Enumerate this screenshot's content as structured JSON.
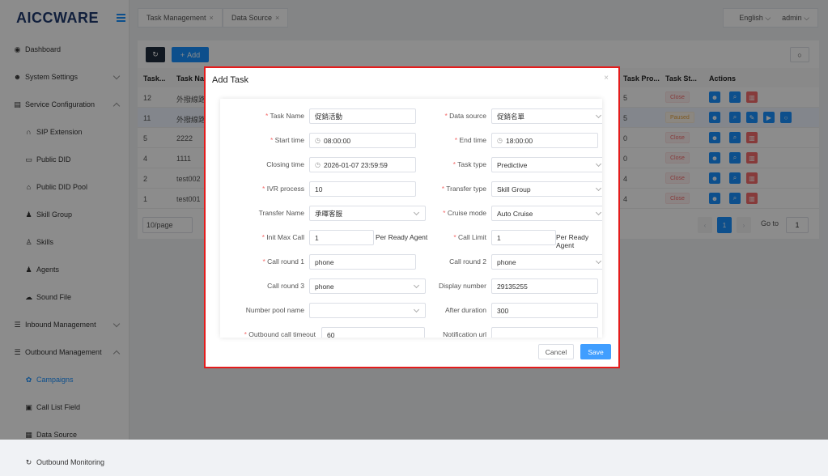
{
  "brand": {
    "name_a": "AICC",
    "name_b": "WARE"
  },
  "sidebar": {
    "items": [
      {
        "label": "Dashboard",
        "icon": "dashboard-icon"
      },
      {
        "label": "System Settings",
        "icon": "users-cog-icon"
      },
      {
        "label": "Service Configuration",
        "icon": "id-card-icon"
      },
      {
        "label": "SIP Extension",
        "icon": "headset-icon"
      },
      {
        "label": "Public DID",
        "icon": "folder-icon"
      },
      {
        "label": "Public DID Pool",
        "icon": "home-icon"
      },
      {
        "label": "Skill Group",
        "icon": "user-tie-icon"
      },
      {
        "label": "Skills",
        "icon": "user-icon"
      },
      {
        "label": "Agents",
        "icon": "agent-icon"
      },
      {
        "label": "Sound File",
        "icon": "cloud-icon"
      },
      {
        "label": "Inbound Management",
        "icon": "list-icon"
      },
      {
        "label": "Outbound Management",
        "icon": "list-icon"
      },
      {
        "label": "Campaigns",
        "icon": "palette-icon"
      },
      {
        "label": "Call List Field",
        "icon": "field-icon"
      },
      {
        "label": "Data Source",
        "icon": "grid-icon"
      },
      {
        "label": "Outbound Monitoring",
        "icon": "sync-icon"
      }
    ]
  },
  "tabs": [
    {
      "label": "Task Management"
    },
    {
      "label": "Data Source"
    }
  ],
  "header": {
    "language": "English",
    "user": "admin"
  },
  "toolbar": {
    "add_label": "Add"
  },
  "table": {
    "headers": [
      "Task...",
      "Task Na",
      "Task Pro...",
      "Task St...",
      "Actions"
    ],
    "rows": [
      {
        "id": "12",
        "name": "外撥線路",
        "progress": "5",
        "status": "Close"
      },
      {
        "id": "11",
        "name": "外撥線路",
        "progress": "5",
        "status": "Paused"
      },
      {
        "id": "5",
        "name": "2222",
        "progress": "0",
        "status": "Close"
      },
      {
        "id": "4",
        "name": "1111",
        "progress": "0",
        "status": "Close"
      },
      {
        "id": "2",
        "name": "test002",
        "progress": "4",
        "status": "Close"
      },
      {
        "id": "1",
        "name": "test001",
        "progress": "4",
        "status": "Close"
      }
    ]
  },
  "pager": {
    "page_size": "10/page",
    "current": "1",
    "goto_label": "Go to",
    "goto_value": "1"
  },
  "dialog": {
    "title": "Add Task",
    "close": "×",
    "fields": {
      "task_name": {
        "label": "Task Name",
        "value": "促銷活動"
      },
      "data_source": {
        "label": "Data source",
        "value": "促銷名單"
      },
      "start_time": {
        "label": "Start time",
        "value": "08:00:00"
      },
      "end_time": {
        "label": "End time",
        "value": "18:00:00"
      },
      "closing_time": {
        "label": "Closing time",
        "value": "2026-01-07 23:59:59"
      },
      "task_type": {
        "label": "Task type",
        "value": "Predictive"
      },
      "ivr_process": {
        "label": "IVR process",
        "value": "10"
      },
      "transfer_type": {
        "label": "Transfer type",
        "value": "Skill Group"
      },
      "transfer_name": {
        "label": "Transfer Name",
        "value": "承暉客服"
      },
      "cruise_mode": {
        "label": "Cruise mode",
        "value": "Auto Cruise"
      },
      "init_max_call": {
        "label": "Init Max Call",
        "value": "1",
        "suffix": "Per Ready Agent"
      },
      "call_limit": {
        "label": "Call Limit",
        "value": "1",
        "suffix": "Per Ready Agent"
      },
      "call_round_1": {
        "label": "Call round 1",
        "value": "phone"
      },
      "call_round_2": {
        "label": "Call round 2",
        "value": "phone"
      },
      "call_round_3": {
        "label": "Call round 3",
        "value": "phone"
      },
      "display_number": {
        "label": "Display number",
        "value": "29135255"
      },
      "number_pool_name": {
        "label": "Number pool name",
        "value": ""
      },
      "after_duration": {
        "label": "After duration",
        "value": "300"
      },
      "outbound_call_timeout": {
        "label": "Outbound call timeout",
        "value": "60"
      },
      "notification_url": {
        "label": "Notification url",
        "value": ""
      }
    },
    "cancel_label": "Cancel",
    "save_label": "Save"
  }
}
